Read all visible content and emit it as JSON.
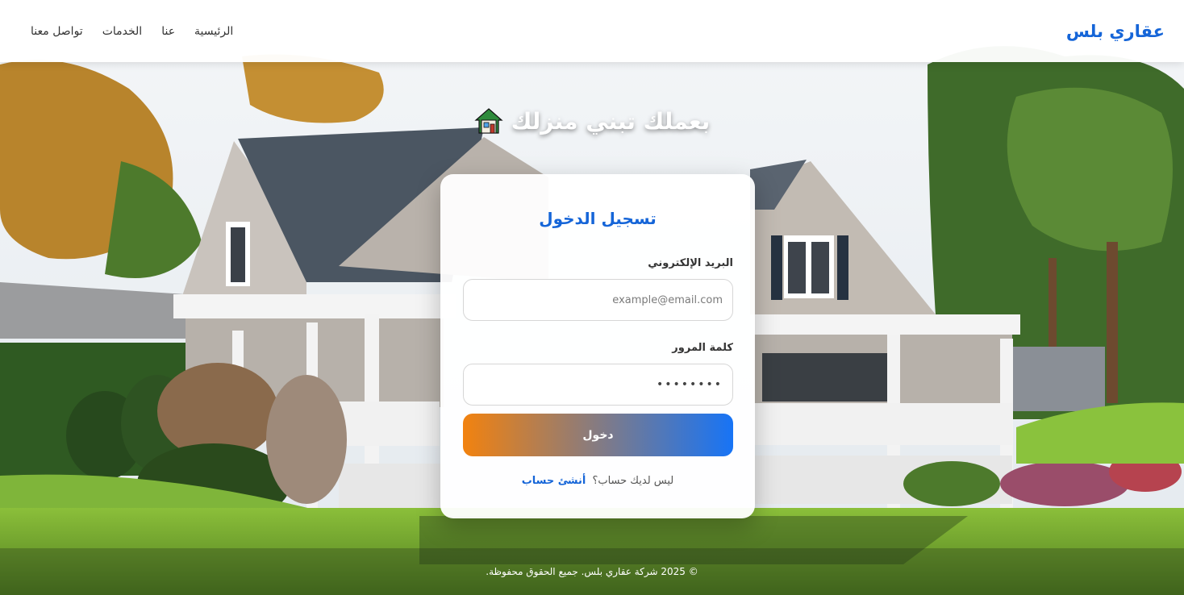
{
  "header": {
    "brand": "عقاري بلس",
    "nav": {
      "home": "الرئيسية",
      "about": "عنا",
      "services": "الخدمات",
      "contact": "تواصل معنا"
    }
  },
  "hero": {
    "title": "بعملك تبني منزلك",
    "icon": "house-emoji-icon"
  },
  "login": {
    "title": "تسجيل الدخول",
    "email_label": "البريد الإلكتروني",
    "email_placeholder": "example@email.com",
    "email_value": "",
    "password_label": "كلمة المرور",
    "password_value": "••••••••",
    "submit_label": "دخول",
    "no_account_text": "ليس لديك حساب؟",
    "create_account_link": "أنشئ حساب"
  },
  "footer": {
    "copyright": "© 2025 شركة عقاري بلس. جميع الحقوق محفوظة."
  },
  "colors": {
    "brand_blue": "#1565d8",
    "gradient_start": "#f2820f",
    "gradient_end": "#1774f6"
  }
}
